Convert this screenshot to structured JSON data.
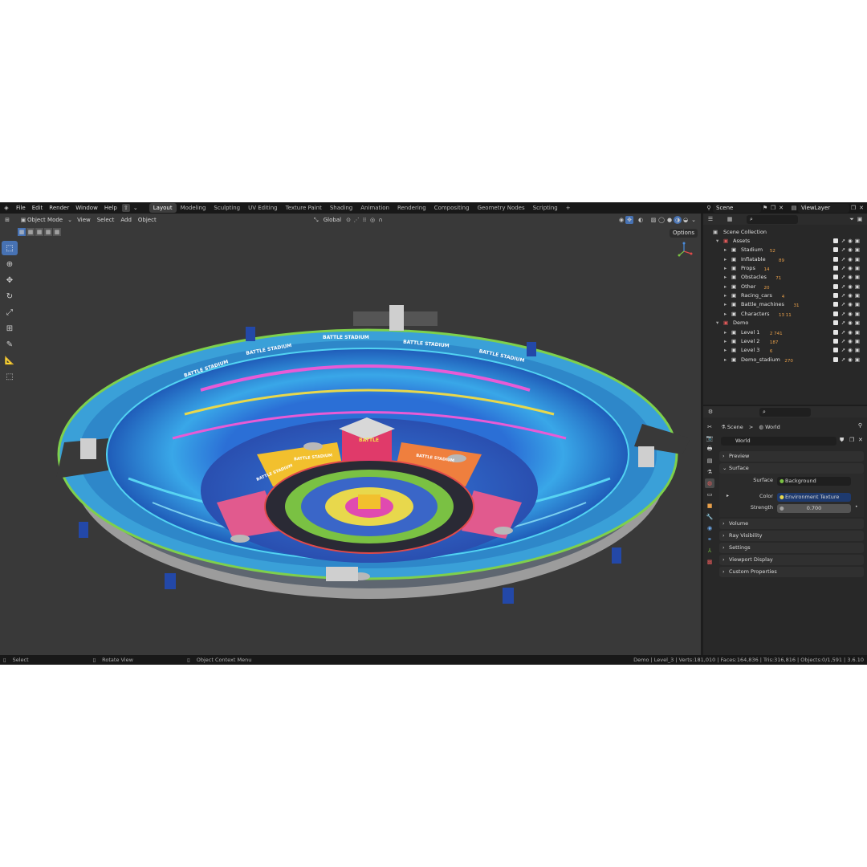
{
  "topbar": {
    "menus": [
      "File",
      "Edit",
      "Render",
      "Window",
      "Help"
    ],
    "workspaces": [
      "Layout",
      "Modeling",
      "Sculpting",
      "UV Editing",
      "Texture Paint",
      "Shading",
      "Animation",
      "Rendering",
      "Compositing",
      "Geometry Nodes",
      "Scripting"
    ],
    "active_workspace": "Layout",
    "add_tab": "+",
    "scene_label": "Scene",
    "viewlayer_label": "ViewLayer"
  },
  "viewport": {
    "mode": "Object Mode",
    "menus": [
      "View",
      "Select",
      "Add",
      "Object"
    ],
    "orientation": "Global",
    "options": "Options",
    "stadium_signs": [
      "BATTLE STADIUM",
      "BATTLE STADIUM",
      "BATTLE STADIUM",
      "BATTLE STADIUM",
      "BATTLE STADIUM",
      "BATTLE STADIUM",
      "BATTLE STADIUM",
      "BATTLE STADIUM"
    ],
    "center_block_label": "BATTLE"
  },
  "outliner": {
    "root": "Scene Collection",
    "rows": [
      {
        "label": "Assets",
        "count": "",
        "level": 1
      },
      {
        "label": "Stadium",
        "count": "52",
        "level": 2
      },
      {
        "label": "Inflatable",
        "count": "89",
        "level": 2
      },
      {
        "label": "Props",
        "count": "14",
        "level": 2
      },
      {
        "label": "Obstacles",
        "count": "71",
        "level": 2
      },
      {
        "label": "Other",
        "count": "20",
        "level": 2
      },
      {
        "label": "Racing_cars",
        "count": "4",
        "level": 2
      },
      {
        "label": "Battle_machines",
        "count": "31",
        "level": 2
      },
      {
        "label": "Characters",
        "count": "13 11",
        "level": 2
      },
      {
        "label": "Demo",
        "count": "",
        "level": 1
      },
      {
        "label": "Level 1",
        "count": "2 741",
        "level": 2
      },
      {
        "label": "Level 2",
        "count": "187",
        "level": 2
      },
      {
        "label": "Level 3",
        "count": "6",
        "level": 2
      },
      {
        "label": "Demo_stadium",
        "count": "270",
        "level": 2
      }
    ]
  },
  "properties": {
    "breadcrumb_scene": "Scene",
    "breadcrumb_sep": ">",
    "breadcrumb_world": "World",
    "world_name": "World",
    "panels": {
      "preview": "Preview",
      "surface": "Surface",
      "volume": "Volume",
      "ray_visibility": "Ray Visibility",
      "settings": "Settings",
      "viewport_display": "Viewport Display",
      "custom_properties": "Custom Properties"
    },
    "surface_label": "Surface",
    "surface_value": "Background",
    "color_label": "Color",
    "color_value": "Environment Texture",
    "strength_label": "Strength",
    "strength_value": "0.700"
  },
  "statusbar": {
    "select": "Select",
    "rotate": "Rotate View",
    "context": "Object Context Menu",
    "stats": "Demo | Level_3 | Verts:181,010 | Faces:164,836 | Tris:316,816 | Objects:0/1,591 | 3.6.10"
  },
  "colors": {
    "accent": "#4772b3",
    "viewport_bg": "#393939",
    "panel_bg": "#282828",
    "count_orange": "#e9a04a"
  }
}
